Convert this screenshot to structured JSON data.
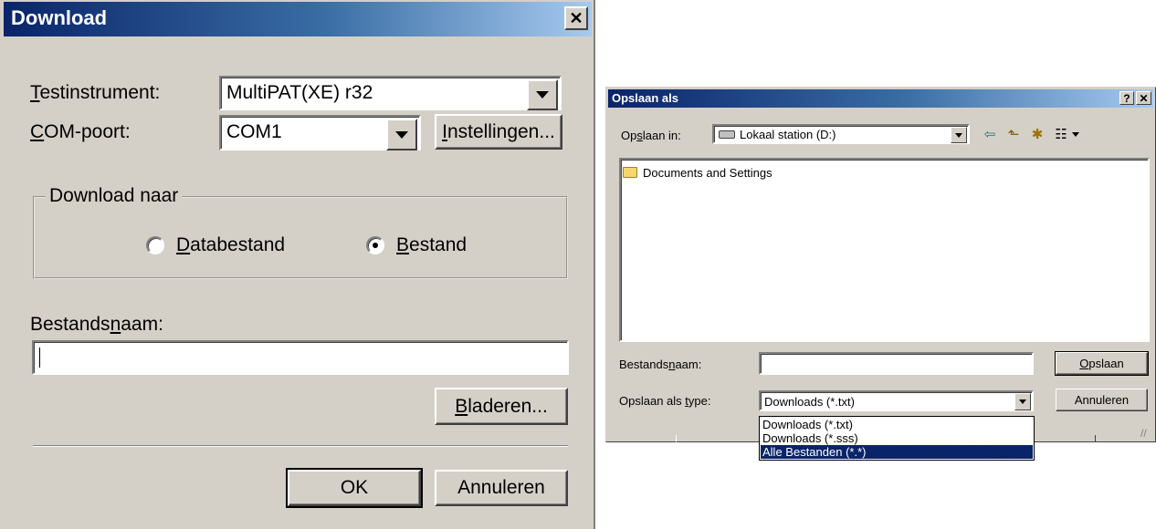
{
  "download_dialog": {
    "title": "Download",
    "close_symbol": "✕",
    "instrument": {
      "label_u": "T",
      "label_rest": "estinstrument:",
      "value": "MultiPAT(XE) r32"
    },
    "com": {
      "label_u": "C",
      "label_rest": "OM-poort:",
      "value": "COM1",
      "settings_u": "I",
      "settings_rest": "nstellingen..."
    },
    "group_label": "Download naar",
    "radio_database": {
      "u": "D",
      "rest": "atabestand",
      "checked": false
    },
    "radio_file": {
      "u": "B",
      "rest": "estand",
      "checked": true
    },
    "filename": {
      "label_pre": "Bestands",
      "label_u": "n",
      "label_post": "aam:",
      "value": ""
    },
    "browse": {
      "u": "B",
      "rest": "laderen..."
    },
    "ok_label": "OK",
    "cancel_label": "Annuleren"
  },
  "save_dialog": {
    "title": "Opslaan als",
    "help_symbol": "?",
    "close_symbol": "✕",
    "save_in": {
      "label_pre": "Op",
      "label_u": "s",
      "label_post": "laan in:",
      "value": "Lokaal station (D:)",
      "icon": "drive-icon"
    },
    "toolbar": {
      "back": "⇦",
      "up": "⬑",
      "new_folder": "✱",
      "view": "☷"
    },
    "files": [
      {
        "name": "Documents and Settings",
        "icon": "folder-icon"
      }
    ],
    "filename": {
      "label_pre": "Bestands",
      "label_u": "n",
      "label_post": "aam:",
      "value": ""
    },
    "save_button": {
      "u": "O",
      "rest": "pslaan"
    },
    "type": {
      "label_pre": "Opslaan als ",
      "label_u": "t",
      "label_post": "ype:",
      "value": "Downloads (*.txt)"
    },
    "cancel_label": "Annuleren",
    "type_options": [
      "Downloads (*.txt)",
      "Downloads (*.sss)",
      "Alle Bestanden (*.*)"
    ],
    "selected_option": 2
  }
}
